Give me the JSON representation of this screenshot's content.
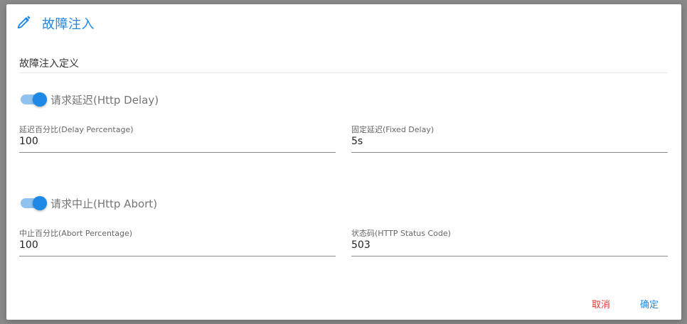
{
  "dialog": {
    "title": "故障注入",
    "icon": "pencil-icon",
    "accent_color": "#1e88e5"
  },
  "section": {
    "title": "故障注入定义"
  },
  "delay": {
    "toggle_label": "请求延迟(Http Delay)",
    "enabled": true,
    "percentage": {
      "label": "延迟百分比(Delay Percentage)",
      "value": "100"
    },
    "fixed_delay": {
      "label": "固定延迟(Fixed Delay)",
      "value": "5s"
    }
  },
  "abort": {
    "toggle_label": "请求中止(Http Abort)",
    "enabled": true,
    "percentage": {
      "label": "中止百分比(Abort Percentage)",
      "value": "100"
    },
    "status_code": {
      "label": "状态码(HTTP Status Code)",
      "value": "503"
    }
  },
  "actions": {
    "cancel_label": "取消",
    "cancel_color": "#e53935",
    "ok_label": "确定",
    "ok_color": "#1e88e5"
  }
}
